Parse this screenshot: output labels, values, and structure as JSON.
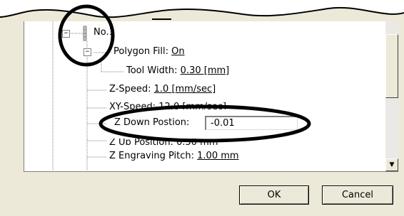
{
  "tree": {
    "root_label": "No.1",
    "polygon_fill": {
      "label": "Polygon Fill: ",
      "value": "On"
    },
    "tool_width": {
      "label": "Tool Width: ",
      "value": "0.30 [mm]"
    },
    "z_speed": {
      "label": "Z-Speed: ",
      "value": "1.0 [mm/sec]"
    },
    "xy_speed": {
      "label": "XY-Speed: ",
      "value": "12.0 [mm/sec]"
    },
    "z_down": {
      "label": "Z Down Postion:",
      "value": "-0.01"
    },
    "z_up": {
      "label": "Z Up Position: ",
      "value": "0.50 mm"
    },
    "z_engraving_pitch": {
      "label": "Z Engraving Pitch: ",
      "value": "1.00 mm"
    }
  },
  "buttons": {
    "ok": "OK",
    "cancel": "Cancel"
  },
  "icons": {
    "expander_open": "−",
    "scroll_down": "▼"
  },
  "colors": {
    "dialog_bg": "#ece9d8",
    "highlight_ring": "#000000"
  }
}
